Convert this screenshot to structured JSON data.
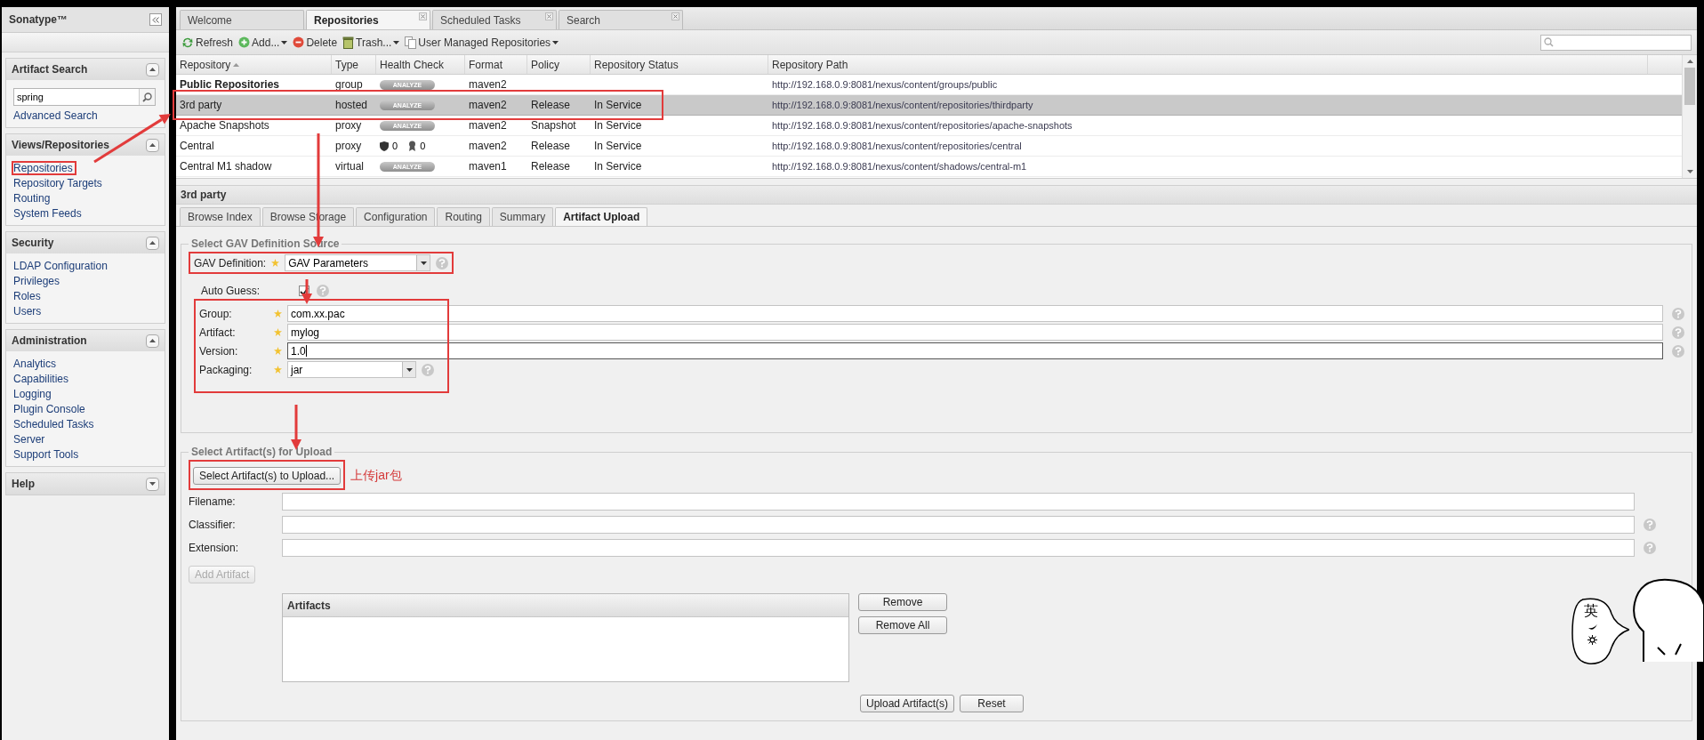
{
  "sidebar": {
    "title": "Sonatype™",
    "panels": [
      {
        "title": "Artifact Search",
        "expanded": true,
        "search": {
          "value": "spring"
        },
        "links": [
          {
            "label": "Advanced Search",
            "marked": false
          }
        ]
      },
      {
        "title": "Views/Repositories",
        "expanded": true,
        "links": [
          {
            "label": "Repositories",
            "marked": true
          },
          {
            "label": "Repository Targets",
            "marked": false
          },
          {
            "label": "Routing",
            "marked": false
          },
          {
            "label": "System Feeds",
            "marked": false
          }
        ]
      },
      {
        "title": "Security",
        "expanded": true,
        "links": [
          {
            "label": "LDAP Configuration",
            "marked": false
          },
          {
            "label": "Privileges",
            "marked": false
          },
          {
            "label": "Roles",
            "marked": false
          },
          {
            "label": "Users",
            "marked": false
          }
        ]
      },
      {
        "title": "Administration",
        "expanded": true,
        "links": [
          {
            "label": "Analytics",
            "marked": false
          },
          {
            "label": "Capabilities",
            "marked": false
          },
          {
            "label": "Logging",
            "marked": false
          },
          {
            "label": "Plugin Console",
            "marked": false
          },
          {
            "label": "Scheduled Tasks",
            "marked": false
          },
          {
            "label": "Server",
            "marked": false
          },
          {
            "label": "Support Tools",
            "marked": false
          }
        ]
      },
      {
        "title": "Help",
        "expanded": false
      }
    ]
  },
  "tabs": [
    {
      "label": "Welcome",
      "selected": false,
      "closable": false
    },
    {
      "label": "Repositories",
      "selected": true,
      "closable": true
    },
    {
      "label": "Scheduled Tasks",
      "selected": false,
      "closable": true
    },
    {
      "label": "Search",
      "selected": false,
      "closable": true
    }
  ],
  "toolbar": [
    {
      "kind": "refresh",
      "label": "Refresh",
      "dropdown": false
    },
    {
      "kind": "add",
      "label": "Add...",
      "dropdown": true
    },
    {
      "kind": "delete",
      "label": "Delete",
      "dropdown": false
    },
    {
      "kind": "trash",
      "label": "Trash...",
      "dropdown": true
    },
    {
      "kind": "copy",
      "label": "User Managed Repositories",
      "dropdown": true
    }
  ],
  "table": {
    "columns": [
      "Repository",
      "Type",
      "Health Check",
      "Format",
      "Policy",
      "Repository Status",
      "Repository Path"
    ],
    "rows": [
      {
        "name": "Public Repositories",
        "bold": true,
        "type": "group",
        "health": {
          "kind": "analyze",
          "label": "ANALYZE"
        },
        "format": "maven2",
        "policy": "",
        "status": "",
        "path": "http://192.168.0.9:8081/nexus/content/groups/public",
        "selected": false,
        "marked": false
      },
      {
        "name": "3rd party",
        "bold": false,
        "type": "hosted",
        "health": {
          "kind": "analyze",
          "label": "ANALYZE"
        },
        "format": "maven2",
        "policy": "Release",
        "status": "In Service",
        "path": "http://192.168.0.9:8081/nexus/content/repositories/thirdparty",
        "selected": true,
        "marked": true
      },
      {
        "name": "Apache Snapshots",
        "bold": false,
        "type": "proxy",
        "health": {
          "kind": "analyze",
          "label": "ANALYZE"
        },
        "format": "maven2",
        "policy": "Snapshot",
        "status": "In Service",
        "path": "http://192.168.0.9:8081/nexus/content/repositories/apache-snapshots",
        "selected": false,
        "marked": false
      },
      {
        "name": "Central",
        "bold": false,
        "type": "proxy",
        "health": {
          "kind": "counts",
          "security": "0",
          "license": "0"
        },
        "format": "maven2",
        "policy": "Release",
        "status": "In Service",
        "path": "http://192.168.0.9:8081/nexus/content/repositories/central",
        "selected": false,
        "marked": false
      },
      {
        "name": "Central M1 shadow",
        "bold": false,
        "type": "virtual",
        "health": {
          "kind": "analyze",
          "label": "ANALYZE"
        },
        "format": "maven1",
        "policy": "Release",
        "status": "In Service",
        "path": "http://192.168.0.9:8081/nexus/content/shadows/central-m1",
        "selected": false,
        "marked": false
      }
    ]
  },
  "detail": {
    "title": "3rd party",
    "tabs": [
      {
        "label": "Browse Index",
        "selected": false
      },
      {
        "label": "Browse Storage",
        "selected": false
      },
      {
        "label": "Configuration",
        "selected": false
      },
      {
        "label": "Routing",
        "selected": false
      },
      {
        "label": "Summary",
        "selected": false
      },
      {
        "label": "Artifact Upload",
        "selected": true
      }
    ],
    "gav_source": {
      "legend": "Select GAV Definition Source",
      "definition": {
        "label": "GAV Definition:",
        "value": "GAV Parameters",
        "marked": true
      },
      "auto_guess": {
        "label": "Auto Guess:",
        "checked": true
      },
      "fields": [
        {
          "kind": "text",
          "label": "Group:",
          "value": "com.xx.pac",
          "focused": false
        },
        {
          "kind": "text",
          "label": "Artifact:",
          "value": "mylog",
          "focused": false
        },
        {
          "kind": "text",
          "label": "Version:",
          "value": "1.0",
          "focused": true
        },
        {
          "kind": "select",
          "label": "Packaging:",
          "value": "jar",
          "focused": false
        }
      ],
      "fields_marked": true
    },
    "upload": {
      "legend": "Select Artifact(s) for Upload",
      "select_button": {
        "label": "Select Artifact(s) to Upload...",
        "marked": true
      },
      "note": "上传jar包",
      "fields": [
        {
          "label": "Filename:",
          "help": false
        },
        {
          "label": "Classifier:",
          "help": true
        },
        {
          "label": "Extension:",
          "help": true
        }
      ],
      "add_button": {
        "label": "Add Artifact",
        "disabled": true
      },
      "artifacts_title": "Artifacts",
      "side_buttons": [
        "Remove",
        "Remove All"
      ],
      "buttons": [
        "Upload Artifact(s)",
        "Reset"
      ]
    }
  },
  "sticker": {
    "bubble_text": "英"
  }
}
